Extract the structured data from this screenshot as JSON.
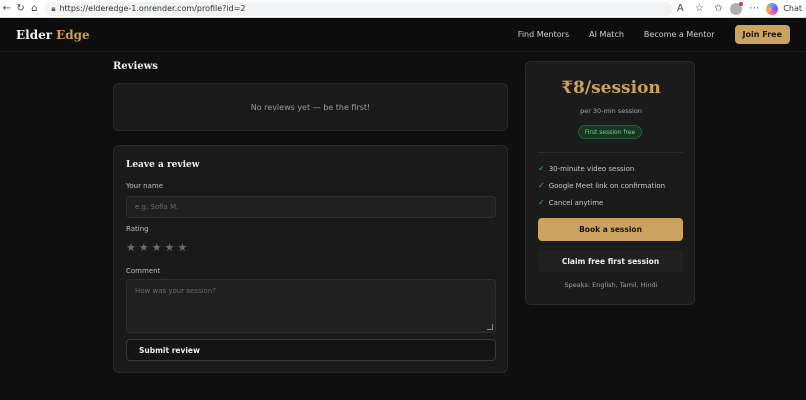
{
  "browser": {
    "url": "https://elderedge-1.onrender.com/profile?id=2",
    "chat_label": "Chat"
  },
  "nav": {
    "logo_main": "Elder",
    "logo_accent": "Edge",
    "links": [
      "Find Mentors",
      "AI Match",
      "Become a Mentor"
    ],
    "join_label": "Join Free"
  },
  "reviews": {
    "title": "Reviews",
    "empty_text": "No reviews yet — be the first!"
  },
  "review_form": {
    "title": "Leave a review",
    "name_label": "Your name",
    "name_placeholder": "e.g. Sofia M.",
    "rating_label": "Rating",
    "rating_value": 0,
    "stars": [
      "★",
      "★",
      "★",
      "★",
      "★"
    ],
    "comment_label": "Comment",
    "comment_placeholder": "How was your session?",
    "submit_label": "Submit review"
  },
  "pricing": {
    "price": "₹8/session",
    "per": "per 30-min session",
    "badge": "First session free",
    "features": [
      "30-minute video session",
      "Google Meet link on confirmation",
      "Cancel anytime"
    ],
    "book_label": "Book a session",
    "claim_label": "Claim free first session",
    "speaks": "Speaks: English, Tamil, Hindi"
  },
  "colors": {
    "accent": "#c9a35f",
    "background": "#0f0f0f",
    "badge_green": "#6fd18d"
  }
}
